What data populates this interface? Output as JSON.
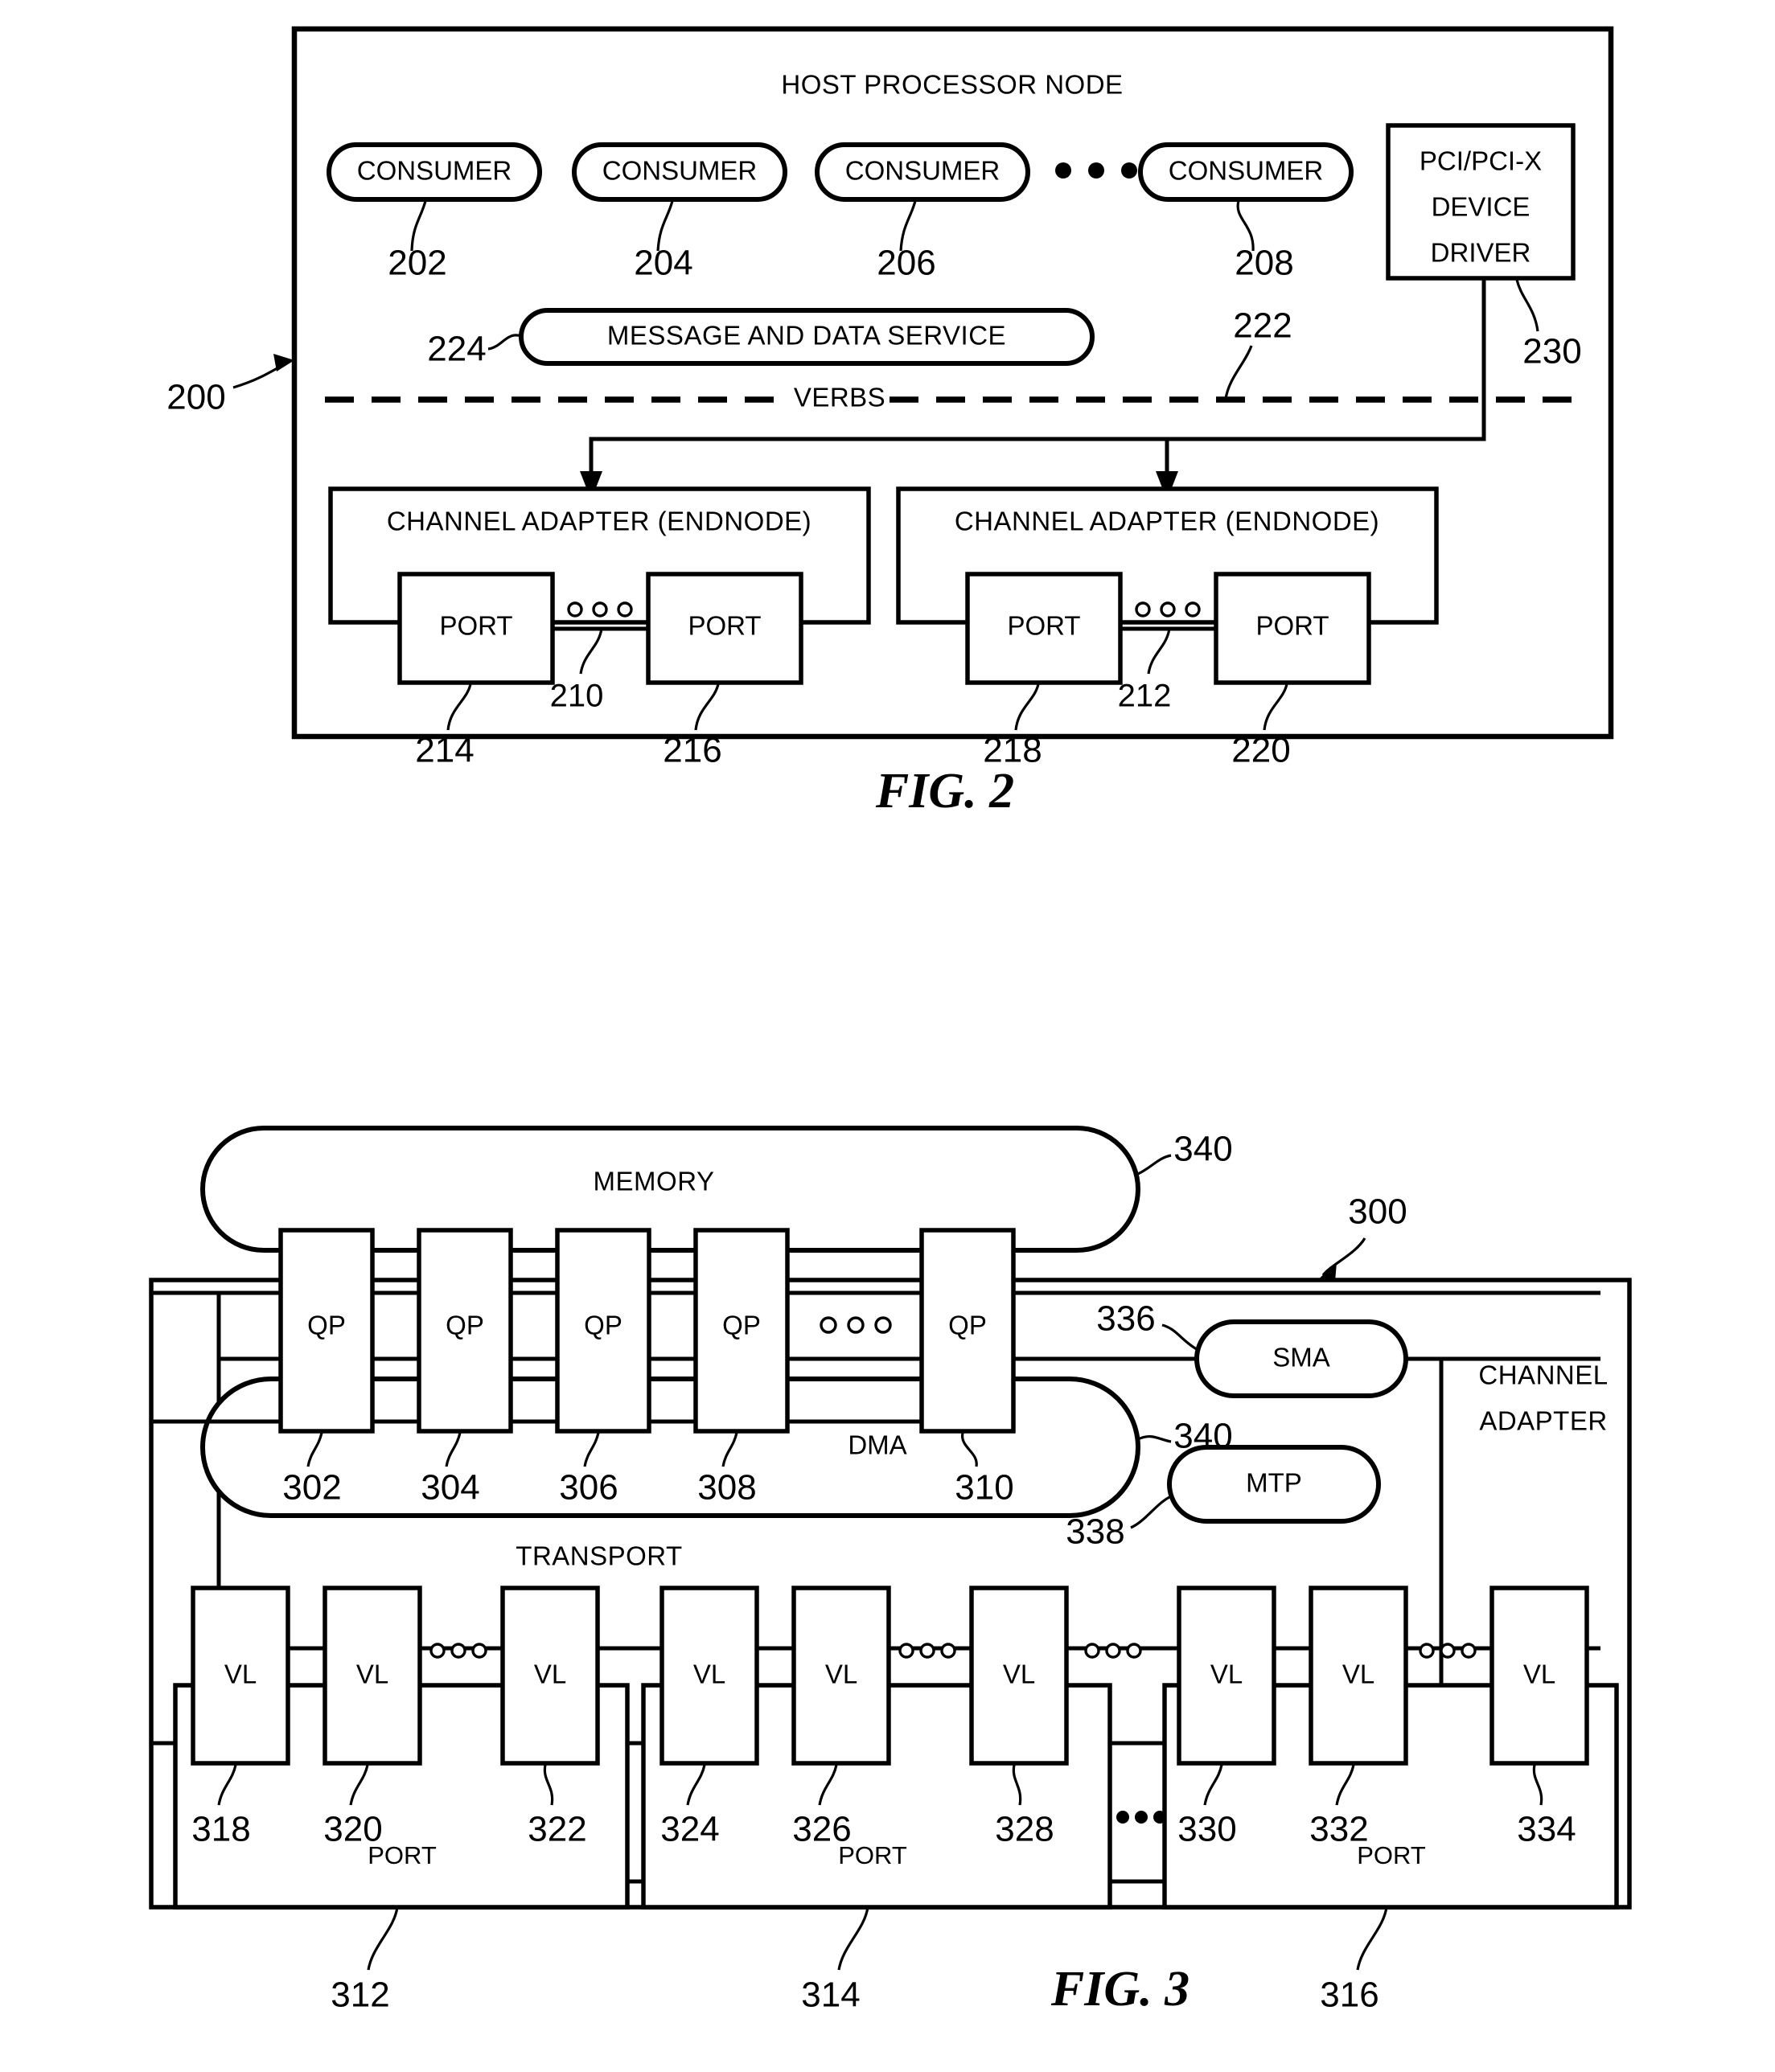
{
  "figure2": {
    "caption": "FIG. 2",
    "outer_ref": "200",
    "title": "HOST PROCESSOR NODE",
    "consumers": [
      {
        "label": "CONSUMER",
        "ref": "202"
      },
      {
        "label": "CONSUMER",
        "ref": "204"
      },
      {
        "label": "CONSUMER",
        "ref": "206"
      },
      {
        "label": "CONSUMER",
        "ref": "208"
      }
    ],
    "consumer_ellipsis": "o o o",
    "device_driver": {
      "line1": "PCI/PCI-X",
      "line2": "DEVICE",
      "line3": "DRIVER",
      "ref": "230"
    },
    "message_service": {
      "label": "MESSAGE AND DATA SERVICE",
      "ref": "224"
    },
    "verbs": {
      "label": "VERBS",
      "ref": "222"
    },
    "channel_adapters": [
      {
        "label": "CHANNEL ADAPTER (ENDNODE)",
        "ellipsis": "o o o",
        "link_ref": "210",
        "ports": [
          {
            "label": "PORT",
            "ref": "214"
          },
          {
            "label": "PORT",
            "ref": "216"
          }
        ]
      },
      {
        "label": "CHANNEL ADAPTER (ENDNODE)",
        "ellipsis": "o o o",
        "link_ref": "212",
        "ports": [
          {
            "label": "PORT",
            "ref": "218"
          },
          {
            "label": "PORT",
            "ref": "220"
          }
        ]
      }
    ]
  },
  "figure3": {
    "caption": "FIG. 3",
    "outer_ref": "300",
    "adapter_label_line1": "CHANNEL",
    "adapter_label_line2": "ADAPTER",
    "memory": {
      "label": "MEMORY",
      "ref": "340"
    },
    "dma": {
      "label": "DMA",
      "ref": "340"
    },
    "transport": {
      "label": "TRANSPORT"
    },
    "sma": {
      "label": "SMA",
      "ref": "336"
    },
    "mtp": {
      "label": "MTP",
      "ref": "338"
    },
    "qps": [
      {
        "label": "QP",
        "ref": "302"
      },
      {
        "label": "QP",
        "ref": "304"
      },
      {
        "label": "QP",
        "ref": "306"
      },
      {
        "label": "QP",
        "ref": "308"
      },
      {
        "label": "QP",
        "ref": "310"
      }
    ],
    "qp_ellipsis": "o o o",
    "vls": [
      {
        "label": "VL",
        "ref": "318"
      },
      {
        "label": "VL",
        "ref": "320"
      },
      {
        "label": "VL",
        "ref": "322"
      },
      {
        "label": "VL",
        "ref": "324"
      },
      {
        "label": "VL",
        "ref": "326"
      },
      {
        "label": "VL",
        "ref": "328"
      },
      {
        "label": "VL",
        "ref": "330"
      },
      {
        "label": "VL",
        "ref": "332"
      },
      {
        "label": "VL",
        "ref": "334"
      }
    ],
    "vl_ellipsis": "ooo",
    "port_ellipsis": "ooo",
    "ports": [
      {
        "label": "PORT",
        "ref": "312"
      },
      {
        "label": "PORT",
        "ref": "314"
      },
      {
        "label": "PORT",
        "ref": "316"
      }
    ]
  }
}
